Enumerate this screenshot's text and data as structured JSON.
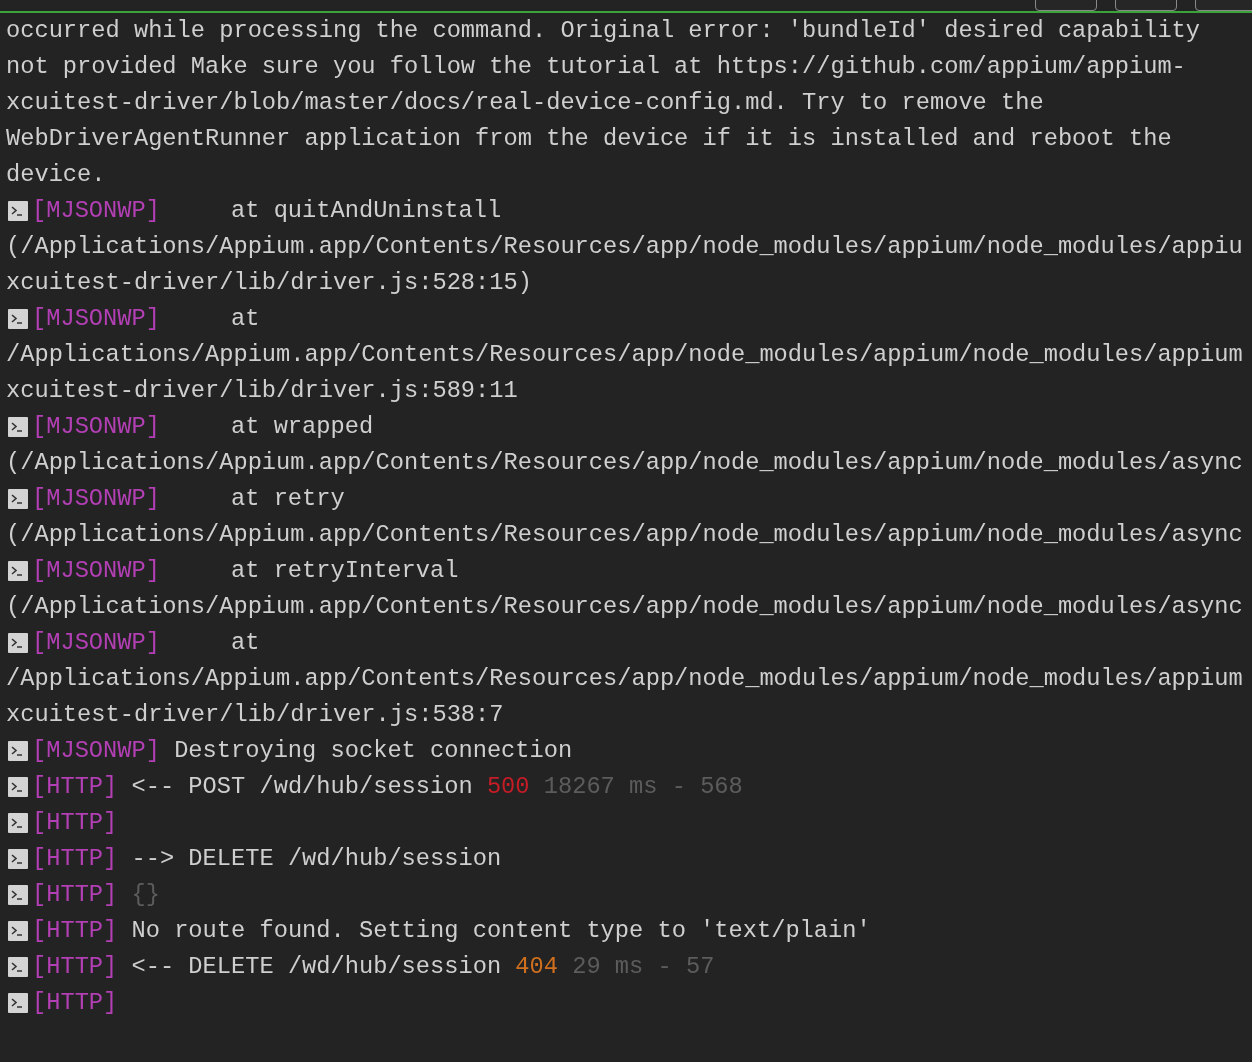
{
  "log": [
    {
      "segments": [
        {
          "kind": "plain",
          "text": "occurred while processing the command. Original error: 'bundleId' desired capability"
        }
      ]
    },
    {
      "segments": [
        {
          "kind": "plain",
          "text": "not provided Make sure you follow the tutorial at https://github.com/appium/appium-"
        }
      ]
    },
    {
      "segments": [
        {
          "kind": "plain",
          "text": "xcuitest-driver/blob/master/docs/real-device-config.md. Try to remove the"
        }
      ]
    },
    {
      "segments": [
        {
          "kind": "plain",
          "text": "WebDriverAgentRunner application from the device if it is installed and reboot the"
        }
      ]
    },
    {
      "segments": [
        {
          "kind": "plain",
          "text": "device."
        }
      ]
    },
    {
      "tag": "[MJSONWP]",
      "segments": [
        {
          "kind": "plain",
          "text": "     at quitAndUninstall"
        }
      ]
    },
    {
      "segments": [
        {
          "kind": "plain",
          "text": "(/Applications/Appium.app/Contents/Resources/app/node_modules/appium/node_modules/appiu"
        }
      ]
    },
    {
      "segments": [
        {
          "kind": "plain",
          "text": "xcuitest-driver/lib/driver.js:528:15)"
        }
      ]
    },
    {
      "tag": "[MJSONWP]",
      "segments": [
        {
          "kind": "plain",
          "text": "     at"
        }
      ]
    },
    {
      "segments": [
        {
          "kind": "plain",
          "text": "/Applications/Appium.app/Contents/Resources/app/node_modules/appium/node_modules/appium"
        }
      ]
    },
    {
      "segments": [
        {
          "kind": "plain",
          "text": "xcuitest-driver/lib/driver.js:589:11"
        }
      ]
    },
    {
      "tag": "[MJSONWP]",
      "segments": [
        {
          "kind": "plain",
          "text": "     at wrapped"
        }
      ]
    },
    {
      "segments": [
        {
          "kind": "plain",
          "text": "(/Applications/Appium.app/Contents/Resources/app/node_modules/appium/node_modules/async"
        }
      ]
    },
    {
      "tag": "[MJSONWP]",
      "segments": [
        {
          "kind": "plain",
          "text": "     at retry"
        }
      ]
    },
    {
      "segments": [
        {
          "kind": "plain",
          "text": "(/Applications/Appium.app/Contents/Resources/app/node_modules/appium/node_modules/async"
        }
      ]
    },
    {
      "tag": "[MJSONWP]",
      "segments": [
        {
          "kind": "plain",
          "text": "     at retryInterval"
        }
      ]
    },
    {
      "segments": [
        {
          "kind": "plain",
          "text": "(/Applications/Appium.app/Contents/Resources/app/node_modules/appium/node_modules/async"
        }
      ]
    },
    {
      "tag": "[MJSONWP]",
      "segments": [
        {
          "kind": "plain",
          "text": "     at"
        }
      ]
    },
    {
      "segments": [
        {
          "kind": "plain",
          "text": "/Applications/Appium.app/Contents/Resources/app/node_modules/appium/node_modules/appium"
        }
      ]
    },
    {
      "segments": [
        {
          "kind": "plain",
          "text": "xcuitest-driver/lib/driver.js:538:7"
        }
      ]
    },
    {
      "tag": "[MJSONWP]",
      "segments": [
        {
          "kind": "plain",
          "text": "Destroying socket connection"
        }
      ]
    },
    {
      "tag": "[HTTP]",
      "segments": [
        {
          "kind": "plain",
          "text": "<-- POST /wd/hub/session"
        },
        {
          "kind": "error",
          "text": "500"
        },
        {
          "kind": "dim",
          "text": "18267 ms - 568"
        }
      ]
    },
    {
      "tag": "[HTTP]"
    },
    {
      "tag": "[HTTP]",
      "segments": [
        {
          "kind": "plain",
          "text": "--> DELETE /wd/hub/session"
        }
      ]
    },
    {
      "tag": "[HTTP]",
      "segments": [
        {
          "kind": "dim",
          "text": "{}"
        }
      ]
    },
    {
      "tag": "[HTTP]",
      "segments": [
        {
          "kind": "plain",
          "text": "No route found. Setting content type to 'text/plain'"
        }
      ]
    },
    {
      "tag": "[HTTP]",
      "segments": [
        {
          "kind": "plain",
          "text": "<-- DELETE /wd/hub/session"
        },
        {
          "kind": "warn",
          "text": "404"
        },
        {
          "kind": "dim",
          "text": "29 ms - 57"
        }
      ]
    },
    {
      "tag": "[HTTP]"
    }
  ]
}
